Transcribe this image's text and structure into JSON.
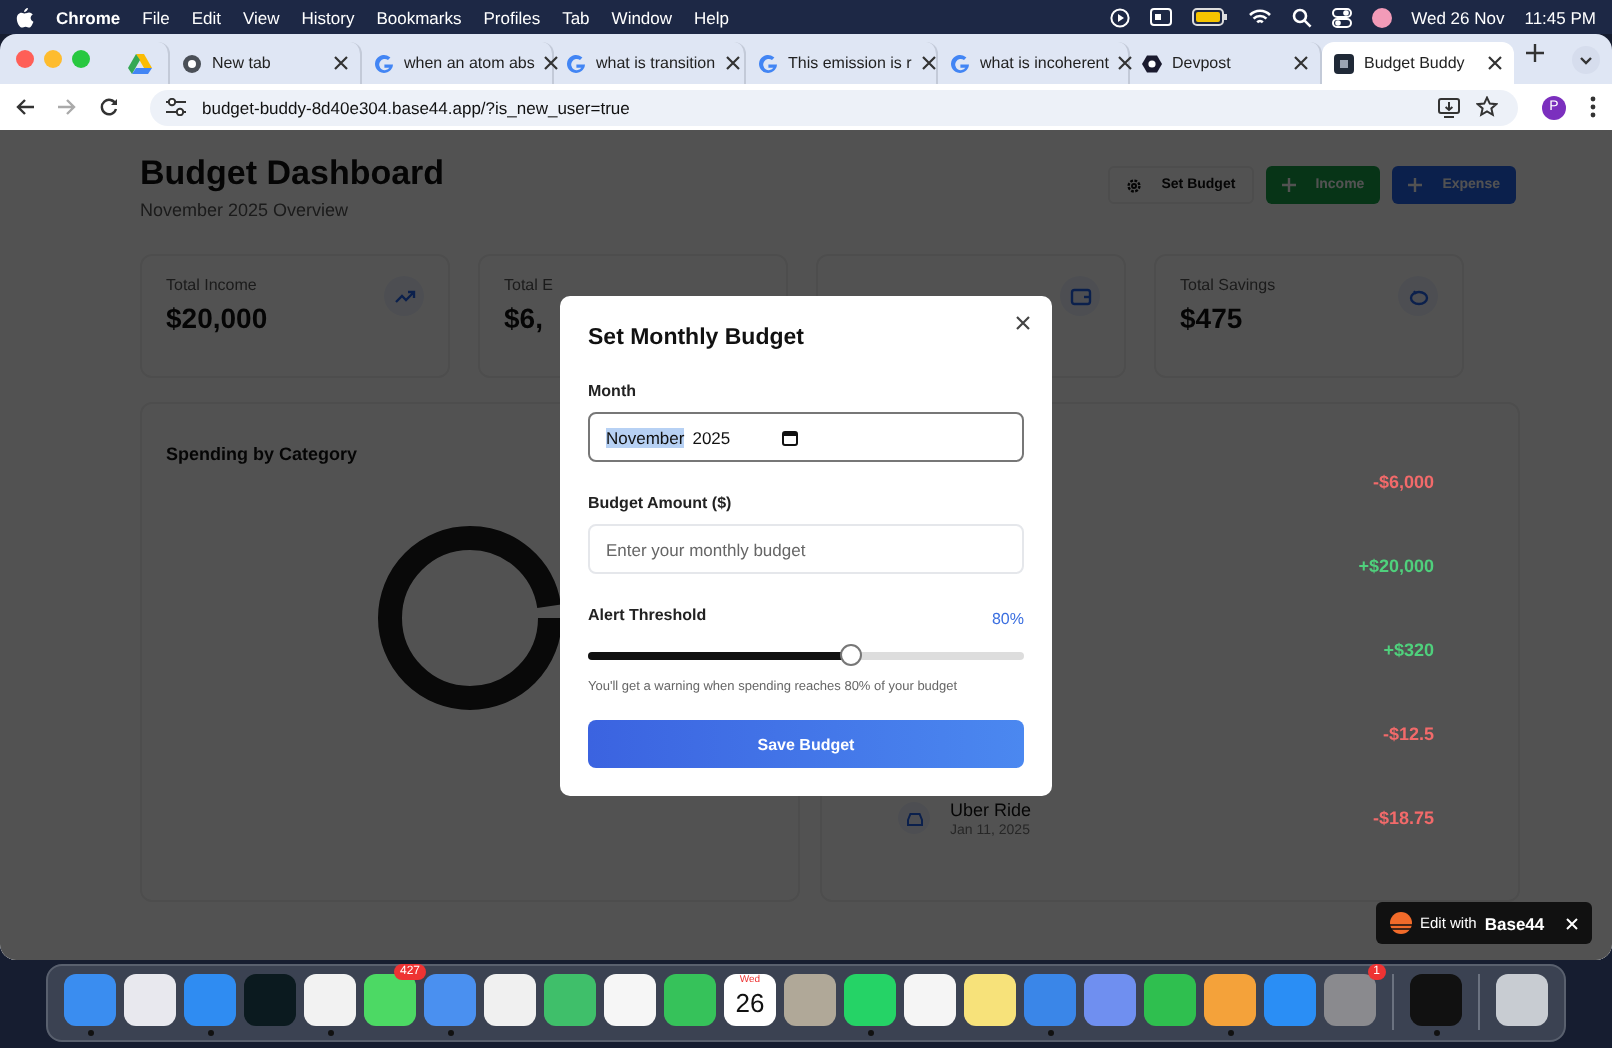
{
  "menu_bar": {
    "app": "Chrome",
    "items": [
      "File",
      "Edit",
      "View",
      "History",
      "Bookmarks",
      "Profiles",
      "Tab",
      "Window",
      "Help"
    ],
    "date": "Wed 26 Nov",
    "time": "11:45 PM"
  },
  "tabs": [
    {
      "kind": "drive",
      "selected": false
    },
    {
      "kind": "chrome",
      "label": "New tab",
      "selected": false
    },
    {
      "kind": "google",
      "label": "when an atom abs",
      "selected": false
    },
    {
      "kind": "google",
      "label": "what is transition",
      "selected": false
    },
    {
      "kind": "google",
      "label": "This emission is r",
      "selected": false
    },
    {
      "kind": "google",
      "label": "what is incoherent",
      "selected": false
    },
    {
      "kind": "devpost",
      "label": "Devpost",
      "selected": false
    },
    {
      "kind": "app",
      "label": "Budget Buddy",
      "selected": true
    }
  ],
  "address_bar": {
    "url": "budget-buddy-8d40e304.base44.app/?is_new_user=true"
  },
  "profile": {
    "initial": "P"
  },
  "dashboard": {
    "title": "Budget Dashboard",
    "subtitle": "November 2025 Overview",
    "buttons": [
      {
        "kind": "settings",
        "label": "Set Budget"
      },
      {
        "kind": "income",
        "label": "Income"
      },
      {
        "kind": "expense",
        "label": "Expense"
      }
    ],
    "stats": [
      {
        "kind": "trend",
        "label": "Total Income",
        "value": "$20,000"
      },
      {
        "kind": "none",
        "label": "Total E",
        "value": "$6,"
      },
      {
        "kind": "wallet"
      },
      {
        "kind": "piggy",
        "label": "Total Savings",
        "value": "$475"
      }
    ],
    "spending_title": "Spending by Category",
    "transactions": [
      {
        "kind": "expense",
        "amount": "-$6,000"
      },
      {
        "kind": "income",
        "amount": "+$20,000"
      },
      {
        "kind": "income",
        "amount": "+$320"
      },
      {
        "kind": "expense",
        "amount": "-$12.5"
      },
      {
        "kind": "expense",
        "name": "Uber Ride",
        "date": "Jan 11, 2025",
        "amount": "-$18.75"
      }
    ]
  },
  "modal": {
    "title": "Set Monthly Budget",
    "month_label": "Month",
    "month": {
      "month": "November",
      "year": "2025",
      "month_selected": true
    },
    "amount_label": "Budget Amount ($)",
    "amount": {
      "placeholder": "Enter your monthly budget"
    },
    "threshold_label": "Alert Threshold",
    "threshold_reading": "80%",
    "threshold": {
      "level": 0.6
    },
    "hint": "You'll get a warning when spending reaches 80% of your budget",
    "save": "Save Budget"
  },
  "badge": {
    "prefix": "Edit with",
    "brand": "Base44"
  },
  "dock": [
    {
      "color": "#3a8df0",
      "running": true
    },
    {
      "color": "#e8e8ee",
      "running": false
    },
    {
      "color": "#2f8cf2",
      "running": true
    },
    {
      "color": "#0b1a1f",
      "running": false
    },
    {
      "color": "#f2f2f2",
      "running": true
    },
    {
      "color": "#4cd964",
      "running": false,
      "badge": "427"
    },
    {
      "color": "#4a90f0",
      "running": true
    },
    {
      "color": "#f0f0f0",
      "running": false
    },
    {
      "color": "#3fbf6a",
      "running": false
    },
    {
      "color": "#f6f6f6",
      "running": false
    },
    {
      "color": "#36c25a",
      "running": false
    },
    {
      "kind": "calendar",
      "day": "Wed",
      "date": "26",
      "running": false
    },
    {
      "color": "#b0a898",
      "running": false
    },
    {
      "color": "#25d366",
      "running": true
    },
    {
      "color": "#f5f5f5",
      "running": false
    },
    {
      "color": "#f7e27a",
      "running": false
    },
    {
      "color": "#3a86e8",
      "running": true
    },
    {
      "color": "#6f8ff0",
      "running": false
    },
    {
      "color": "#2fbf4f",
      "running": false
    },
    {
      "color": "#f4a23a",
      "running": true
    },
    {
      "color": "#2a8ef5",
      "running": false
    },
    {
      "color": "#8a8a8e",
      "running": false,
      "badge": "1"
    },
    {
      "kind": "separator"
    },
    {
      "color": "#111111",
      "running": true
    },
    {
      "kind": "separator"
    },
    {
      "color": "#c8ccd2",
      "running": false
    }
  ]
}
